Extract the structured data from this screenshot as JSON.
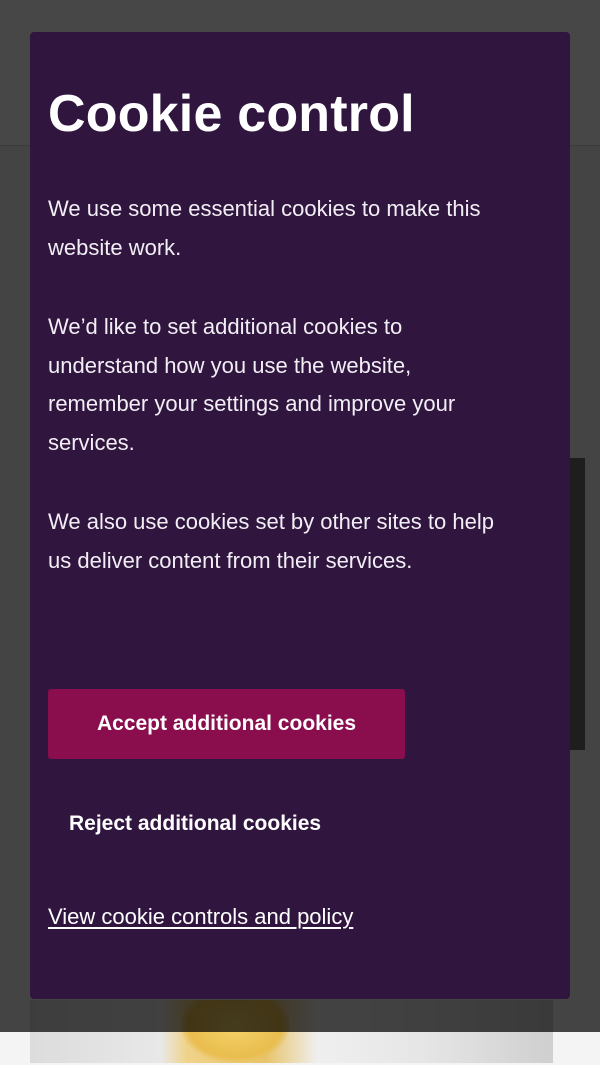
{
  "dialog": {
    "title": "Cookie control",
    "paragraphs": [
      "We use some essential cookies to make this website work.",
      "We’d like to set additional cookies to understand how you use the website, remember your settings and improve your services.",
      "We also use cookies set by other sites to help us deliver content from their services."
    ],
    "accept_label": "Accept additional cookies",
    "reject_label": "Reject additional cookies",
    "policy_link": "View cookie controls and policy"
  },
  "colors": {
    "dialog_bg": "#30163e",
    "accent": "#8a0d4e",
    "text": "#ffffff"
  }
}
